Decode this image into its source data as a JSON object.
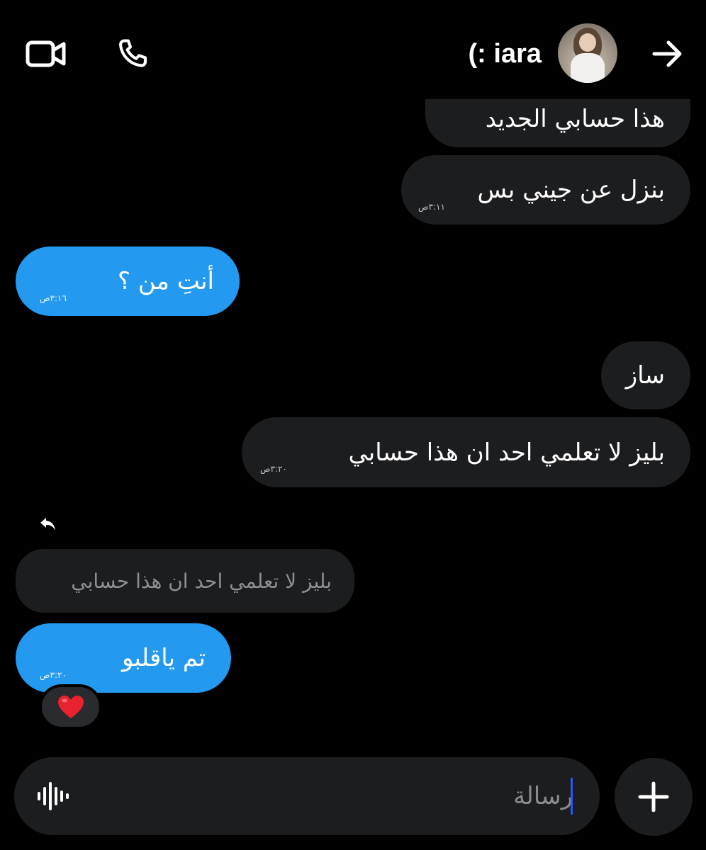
{
  "header": {
    "contact_name": "(: iara",
    "icons": {
      "video": "video-camera-icon",
      "call": "phone-icon",
      "back": "arrow-right-icon",
      "avatar": "profile-photo"
    }
  },
  "messages": [
    {
      "side": "out",
      "text": "هذا حسابي الجديد",
      "time": ""
    },
    {
      "side": "out",
      "text": "بنزل عن جيني بس",
      "time": "٣:١١ص"
    },
    {
      "side": "in",
      "text": "أنتِ من ؟",
      "time": "٣:١٦ص"
    },
    {
      "side": "out",
      "text": "ساز",
      "time": ""
    },
    {
      "side": "out",
      "text": "بليز لا تعلمي احد ان هذا حسابي",
      "time": "٣:٢٠ص"
    },
    {
      "side": "in",
      "reply_to": "بليز لا تعلمي احد ان هذا حسابي",
      "text": "تم ياقلبو",
      "time": "٣:٢٠ص",
      "reaction": "❤️"
    }
  ],
  "composer": {
    "placeholder": "رسالة",
    "icons": {
      "voice": "voice-waveform-icon",
      "add": "plus-icon"
    }
  },
  "colors": {
    "background": "#000000",
    "incoming": "#239af0",
    "outgoing": "#1c1d1f",
    "caret": "#2b55ff"
  }
}
